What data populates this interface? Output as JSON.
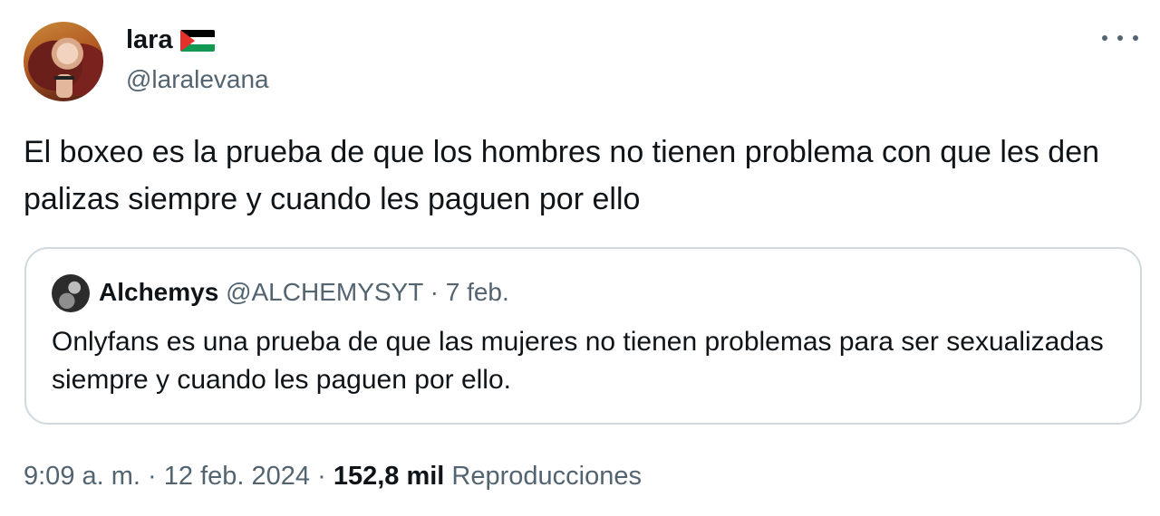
{
  "author": {
    "display_name": "lara",
    "flag_icon": "palestine-flag",
    "handle": "@laralevana"
  },
  "menu_icon": "more-horizontal-icon",
  "tweet": {
    "text": "El boxeo es la prueba de que los hombres no tienen problema con que les den palizas siempre y cuando les paguen por ello"
  },
  "quoted": {
    "display_name": "Alchemys",
    "handle": "@ALCHEMYSYT",
    "separator": "·",
    "date": "7 feb.",
    "text": "Onlyfans es una prueba de que las mujeres no tienen problemas para ser sexualizadas siempre y cuando les paguen por ello."
  },
  "footer": {
    "time": "9:09 a. m.",
    "separator": "·",
    "date": "12 feb. 2024",
    "views_count": "152,8 mil",
    "views_label": "Reproducciones"
  },
  "colors": {
    "text": "#0f1419",
    "secondary": "#536471",
    "border": "#cfd9de"
  }
}
